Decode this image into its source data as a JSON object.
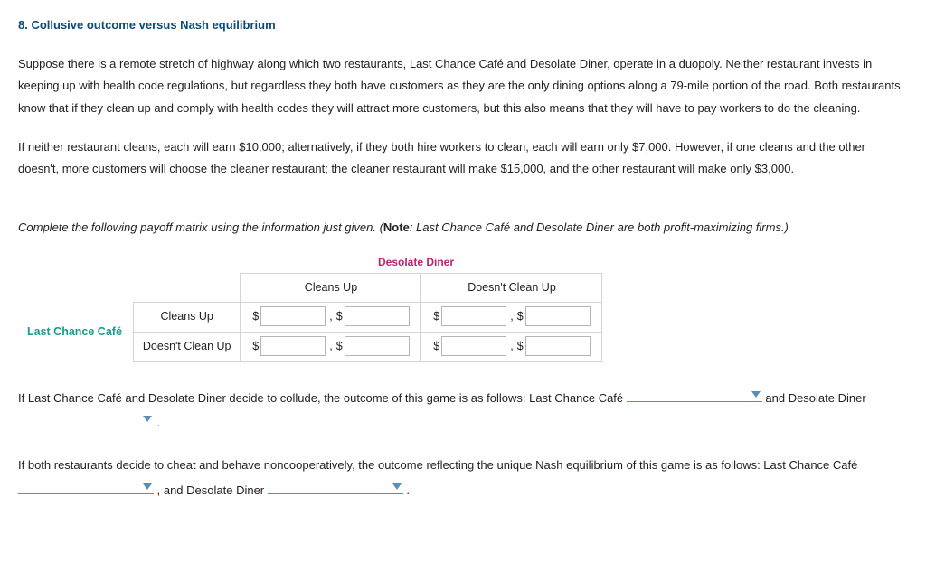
{
  "title": "8. Collusive outcome versus Nash equilibrium",
  "para1": "Suppose there is a remote stretch of highway along which two restaurants, Last Chance Café and Desolate Diner, operate in a duopoly. Neither restaurant invests in keeping up with health code regulations, but regardless they both have customers as they are the only dining options along a 79-mile portion of the road. Both restaurants know that if they clean up and comply with health codes they will attract more customers, but this also means that they will have to pay workers to do the cleaning.",
  "para2": "If neither restaurant cleans, each will earn $10,000; alternatively, if they both hire workers to clean, each will earn only $7,000. However, if one cleans and the other doesn't, more customers will choose the cleaner restaurant; the cleaner restaurant will make $15,000, and the other restaurant will make only $3,000.",
  "instruction_prefix": "Complete the following payoff matrix using the information just given. (",
  "instruction_note_label": "Note",
  "instruction_suffix": ": Last Chance Café and Desolate Diner are both profit-maximizing firms.)",
  "matrix": {
    "col_player": "Desolate Diner",
    "row_player": "Last Chance Café",
    "col_headers": [
      "Cleans Up",
      "Doesn't Clean Up"
    ],
    "row_headers": [
      "Cleans Up",
      "Doesn't Clean Up"
    ],
    "dollar": "$",
    "comma": ",",
    "cells": {
      "r0c0a": "",
      "r0c0b": "",
      "r0c1a": "",
      "r0c1b": "",
      "r1c0a": "",
      "r1c0b": "",
      "r1c1a": "",
      "r1c1b": ""
    }
  },
  "follow1": {
    "t1": "If Last Chance Café and Desolate Diner decide to collude, the outcome of this game is as follows: Last Chance Café ",
    "t2": " and Desolate Diner ",
    "t3": " ."
  },
  "follow2": {
    "t1": "If both restaurants decide to cheat and behave noncooperatively, the outcome reflecting the unique Nash equilibrium of this game is as follows: Last Chance Café ",
    "t2": " , and Desolate Diner ",
    "t3": " ."
  }
}
